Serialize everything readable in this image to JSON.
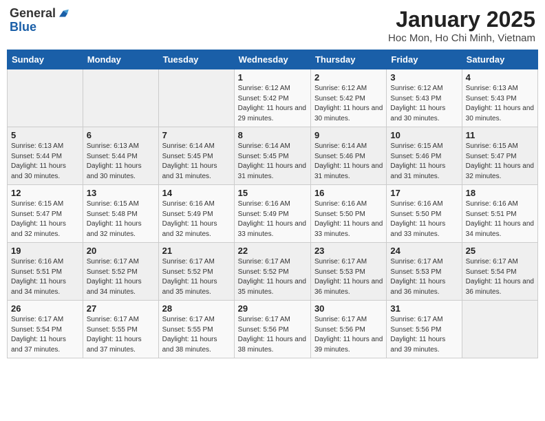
{
  "header": {
    "logo_general": "General",
    "logo_blue": "Blue",
    "title": "January 2025",
    "subtitle": "Hoc Mon, Ho Chi Minh, Vietnam"
  },
  "days_of_week": [
    "Sunday",
    "Monday",
    "Tuesday",
    "Wednesday",
    "Thursday",
    "Friday",
    "Saturday"
  ],
  "weeks": [
    [
      {
        "day": "",
        "info": ""
      },
      {
        "day": "",
        "info": ""
      },
      {
        "day": "",
        "info": ""
      },
      {
        "day": "1",
        "info": "Sunrise: 6:12 AM\nSunset: 5:42 PM\nDaylight: 11 hours and 29 minutes."
      },
      {
        "day": "2",
        "info": "Sunrise: 6:12 AM\nSunset: 5:42 PM\nDaylight: 11 hours and 30 minutes."
      },
      {
        "day": "3",
        "info": "Sunrise: 6:12 AM\nSunset: 5:43 PM\nDaylight: 11 hours and 30 minutes."
      },
      {
        "day": "4",
        "info": "Sunrise: 6:13 AM\nSunset: 5:43 PM\nDaylight: 11 hours and 30 minutes."
      }
    ],
    [
      {
        "day": "5",
        "info": "Sunrise: 6:13 AM\nSunset: 5:44 PM\nDaylight: 11 hours and 30 minutes."
      },
      {
        "day": "6",
        "info": "Sunrise: 6:13 AM\nSunset: 5:44 PM\nDaylight: 11 hours and 30 minutes."
      },
      {
        "day": "7",
        "info": "Sunrise: 6:14 AM\nSunset: 5:45 PM\nDaylight: 11 hours and 31 minutes."
      },
      {
        "day": "8",
        "info": "Sunrise: 6:14 AM\nSunset: 5:45 PM\nDaylight: 11 hours and 31 minutes."
      },
      {
        "day": "9",
        "info": "Sunrise: 6:14 AM\nSunset: 5:46 PM\nDaylight: 11 hours and 31 minutes."
      },
      {
        "day": "10",
        "info": "Sunrise: 6:15 AM\nSunset: 5:46 PM\nDaylight: 11 hours and 31 minutes."
      },
      {
        "day": "11",
        "info": "Sunrise: 6:15 AM\nSunset: 5:47 PM\nDaylight: 11 hours and 32 minutes."
      }
    ],
    [
      {
        "day": "12",
        "info": "Sunrise: 6:15 AM\nSunset: 5:47 PM\nDaylight: 11 hours and 32 minutes."
      },
      {
        "day": "13",
        "info": "Sunrise: 6:15 AM\nSunset: 5:48 PM\nDaylight: 11 hours and 32 minutes."
      },
      {
        "day": "14",
        "info": "Sunrise: 6:16 AM\nSunset: 5:49 PM\nDaylight: 11 hours and 32 minutes."
      },
      {
        "day": "15",
        "info": "Sunrise: 6:16 AM\nSunset: 5:49 PM\nDaylight: 11 hours and 33 minutes."
      },
      {
        "day": "16",
        "info": "Sunrise: 6:16 AM\nSunset: 5:50 PM\nDaylight: 11 hours and 33 minutes."
      },
      {
        "day": "17",
        "info": "Sunrise: 6:16 AM\nSunset: 5:50 PM\nDaylight: 11 hours and 33 minutes."
      },
      {
        "day": "18",
        "info": "Sunrise: 6:16 AM\nSunset: 5:51 PM\nDaylight: 11 hours and 34 minutes."
      }
    ],
    [
      {
        "day": "19",
        "info": "Sunrise: 6:16 AM\nSunset: 5:51 PM\nDaylight: 11 hours and 34 minutes."
      },
      {
        "day": "20",
        "info": "Sunrise: 6:17 AM\nSunset: 5:52 PM\nDaylight: 11 hours and 34 minutes."
      },
      {
        "day": "21",
        "info": "Sunrise: 6:17 AM\nSunset: 5:52 PM\nDaylight: 11 hours and 35 minutes."
      },
      {
        "day": "22",
        "info": "Sunrise: 6:17 AM\nSunset: 5:52 PM\nDaylight: 11 hours and 35 minutes."
      },
      {
        "day": "23",
        "info": "Sunrise: 6:17 AM\nSunset: 5:53 PM\nDaylight: 11 hours and 36 minutes."
      },
      {
        "day": "24",
        "info": "Sunrise: 6:17 AM\nSunset: 5:53 PM\nDaylight: 11 hours and 36 minutes."
      },
      {
        "day": "25",
        "info": "Sunrise: 6:17 AM\nSunset: 5:54 PM\nDaylight: 11 hours and 36 minutes."
      }
    ],
    [
      {
        "day": "26",
        "info": "Sunrise: 6:17 AM\nSunset: 5:54 PM\nDaylight: 11 hours and 37 minutes."
      },
      {
        "day": "27",
        "info": "Sunrise: 6:17 AM\nSunset: 5:55 PM\nDaylight: 11 hours and 37 minutes."
      },
      {
        "day": "28",
        "info": "Sunrise: 6:17 AM\nSunset: 5:55 PM\nDaylight: 11 hours and 38 minutes."
      },
      {
        "day": "29",
        "info": "Sunrise: 6:17 AM\nSunset: 5:56 PM\nDaylight: 11 hours and 38 minutes."
      },
      {
        "day": "30",
        "info": "Sunrise: 6:17 AM\nSunset: 5:56 PM\nDaylight: 11 hours and 39 minutes."
      },
      {
        "day": "31",
        "info": "Sunrise: 6:17 AM\nSunset: 5:56 PM\nDaylight: 11 hours and 39 minutes."
      },
      {
        "day": "",
        "info": ""
      }
    ]
  ]
}
